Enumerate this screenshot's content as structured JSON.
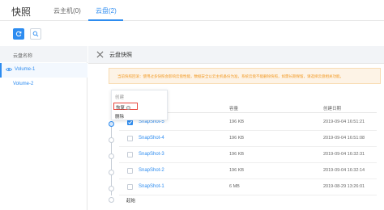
{
  "header": {
    "title": "快照",
    "tabs": [
      {
        "label": "云主机(0)",
        "active": false
      },
      {
        "label": "云盘(2)",
        "active": true
      }
    ]
  },
  "left_panel": {
    "column_header": "云盘名称",
    "volumes": [
      {
        "label": "Volume-1",
        "selected": true
      },
      {
        "label": "Volume-2",
        "selected": false
      }
    ]
  },
  "right_panel": {
    "title": "云盘快照",
    "warning": "当前快照回滚：使用过多快照会影响云盘性能，数据安全以云主机备份为准，系统云盘不能删除快照，如需长期保留，请选择云盘相关功能。"
  },
  "context_menu": {
    "create": "创建",
    "restore": "恢复",
    "delete": "删除"
  },
  "table": {
    "columns": [
      "容量",
      "创建日期"
    ],
    "rows": [
      {
        "name": "SnapShot-5",
        "size": "196 KB",
        "date": "2019-09-04 16:51:21",
        "checked": true
      },
      {
        "name": "SnapShot-4",
        "size": "196 KB",
        "date": "2019-09-04 16:51:08",
        "checked": false
      },
      {
        "name": "SnapShot-3",
        "size": "196 KB",
        "date": "2019-09-04 16:32:31",
        "checked": false
      },
      {
        "name": "SnapShot-2",
        "size": "196 KB",
        "date": "2019-09-04 16:32:14",
        "checked": false
      },
      {
        "name": "SnapShot-1",
        "size": "6 MB",
        "date": "2019-08-29 13:26:01",
        "checked": false
      }
    ],
    "origin_label": "起始"
  },
  "colors": {
    "accent": "#2d8cf0",
    "warning_text": "#f29b26",
    "warning_bg": "#fdf3e6",
    "highlight_border": "#e8453c"
  }
}
